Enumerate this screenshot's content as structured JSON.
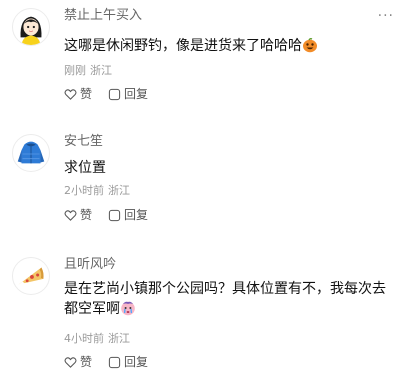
{
  "comments": [
    {
      "username": "禁止上午买入",
      "text": "这哪是休闲野钓，像是进货来了哈哈哈",
      "time": "刚刚",
      "location": "浙江",
      "like_label": "赞",
      "reply_label": "回复",
      "avatar_icon": "girl-avatar",
      "emoji_icon": "grinning-pumpkin-emoji"
    },
    {
      "username": "安七笙",
      "text": "求位置",
      "time": "2小时前",
      "location": "浙江",
      "like_label": "赞",
      "reply_label": "回复",
      "avatar_icon": "blue-jacket-avatar"
    },
    {
      "username": "且听风吟",
      "text": "是在艺尚小镇那个公园吗？具体位置有不，我每次去都空军啊",
      "time": "4小时前",
      "location": "浙江",
      "like_label": "赞",
      "reply_label": "回复",
      "avatar_icon": "pizza-slice-avatar",
      "emoji_icon": "crying-emoji"
    }
  ],
  "more_label": "···",
  "colors": {
    "username": "#666666",
    "meta": "#9a9a9a",
    "text": "#111111"
  }
}
